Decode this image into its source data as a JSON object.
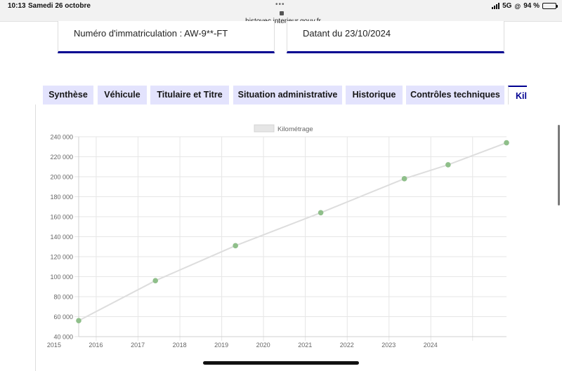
{
  "status_bar": {
    "time": "10:13",
    "date": "Samedi 26 octobre",
    "url": "histovec.interieur.gouv.fr",
    "network": "5G",
    "battery": "94 %",
    "battery_level": 0.94
  },
  "cards": {
    "registration": "Numéro d'immatriculation : AW-9**-FT",
    "date": "Datant du 23/10/2024"
  },
  "tabs": [
    {
      "label": "Synthèse"
    },
    {
      "label": "Véhicule"
    },
    {
      "label": "Titulaire et Titre"
    },
    {
      "label": "Situation administrative"
    },
    {
      "label": "Historique"
    },
    {
      "label": "Contrôles techniques"
    },
    {
      "label": "Kilo"
    }
  ],
  "active_tab": 6,
  "colors": {
    "primary": "#000091",
    "tab_bg": "#e3e3fd",
    "point": "#8fbf8a",
    "line": "#dddddd",
    "grid": "#e6e6e6"
  },
  "chart_data": {
    "type": "line",
    "legend": "Kilométrage",
    "legend_position": "top",
    "grid": true,
    "x_ticks": [
      "2015",
      "2016",
      "2017",
      "2018",
      "2019",
      "2020",
      "2021",
      "2022",
      "2023",
      "2024"
    ],
    "y_ticks": [
      "40 000",
      "60 000",
      "80 000",
      "100 000",
      "120 000",
      "140 000",
      "160 000",
      "180 000",
      "200 000",
      "220 000",
      "240 000"
    ],
    "ylim": [
      40000,
      240000
    ],
    "xlim": [
      "2014-08-01",
      "2024-10-23"
    ],
    "series": [
      {
        "name": "Kilométrage",
        "x": [
          "2014-08-01",
          "2016-06-01",
          "2018-05-01",
          "2020-05-15",
          "2022-05-15",
          "2023-06-01",
          "2024-10-23"
        ],
        "y": [
          56000,
          96000,
          131000,
          164000,
          198000,
          212000,
          234000
        ]
      }
    ]
  }
}
